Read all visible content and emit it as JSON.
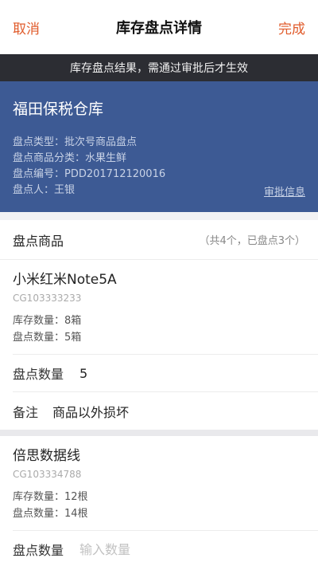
{
  "nav": {
    "cancel": "取消",
    "title": "库存盘点详情",
    "done": "完成"
  },
  "notice": "库存盘点结果，需通过审批后才生效",
  "warehouse": {
    "name": "福田保税仓库",
    "type": "盘点类型：批次号商品盘点",
    "category": "盘点商品分类：水果生鲜",
    "number": "盘点编号：PDD201712120016",
    "person": "盘点人：王银",
    "approval_link": "审批信息"
  },
  "section": {
    "title": "盘点商品",
    "count": "（共4个，已盘点3个）"
  },
  "products": [
    {
      "name": "小米红米Note5A",
      "code": "CG103333233",
      "stock": "库存数量：8箱",
      "counted": "盘点数量：5箱",
      "count_label": "盘点数量",
      "count_value": "5",
      "remark_label": "备注",
      "remark_value": "商品以外损坏"
    },
    {
      "name": "倍思数据线",
      "code": "CG103334788",
      "stock": "库存数量：12根",
      "counted": "盘点数量：14根",
      "count_label": "盘点数量",
      "count_placeholder": "输入数量"
    }
  ]
}
